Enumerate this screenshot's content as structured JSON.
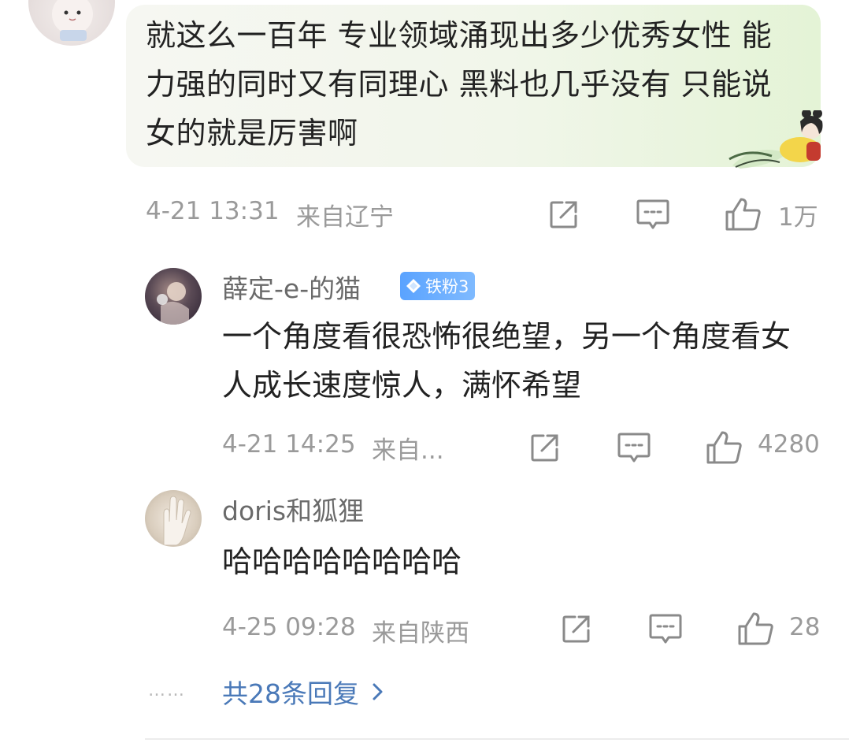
{
  "top_comment": {
    "text": "就这么一百年 专业领域涌现出多少优秀女性 能力强的同时又有同理心  黑料也几乎没有 只能说女的就是厉害啊",
    "time": "4-21 13:31",
    "location": "来自辽宁",
    "likes": "1万"
  },
  "replies": [
    {
      "nickname": "薛定-e-的猫",
      "badge": "铁粉3",
      "text": "一个角度看很恐怖很绝望，另一个角度看女人成长速度惊人，满怀希望",
      "time": "4-21 14:25",
      "location": "来自...",
      "likes": "4280"
    },
    {
      "nickname": "doris和狐狸",
      "text": "哈哈哈哈哈哈哈哈",
      "time": "4-25 09:28",
      "location": "来自陕西",
      "likes": "28"
    }
  ],
  "more_replies": {
    "dots": "……",
    "label": "共28条回复"
  },
  "icons": [
    "share-icon",
    "comment-icon",
    "like-icon",
    "chevron-right-icon",
    "diamond-icon"
  ],
  "colors": {
    "text": "#222222",
    "meta": "#9a9a9a",
    "link": "#4a79b8",
    "badge": "#5aa3ff",
    "bubble": "#eef5e6"
  }
}
